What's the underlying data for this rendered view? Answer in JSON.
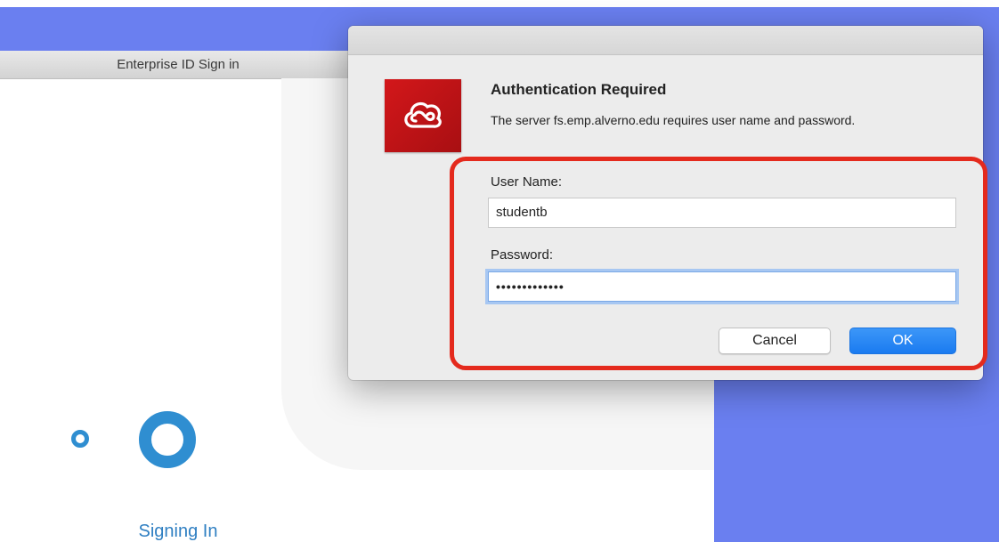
{
  "background_window": {
    "title": "Enterprise ID Sign in",
    "status": "Signing In"
  },
  "dialog": {
    "heading": "Authentication Required",
    "message": "The server fs.emp.alverno.edu requires user name and password.",
    "username_label": "User Name:",
    "username_value": "studentb",
    "password_label": "Password:",
    "password_value": "•••••••••••••",
    "cancel_label": "Cancel",
    "ok_label": "OK",
    "app_icon": "creative-cloud-icon"
  },
  "colors": {
    "desktop": "#6a7ff0",
    "accent": "#2f8ed1",
    "ok_button": "#1a7bf0",
    "highlight": "#e42a1d",
    "logo": "#d3171a"
  }
}
